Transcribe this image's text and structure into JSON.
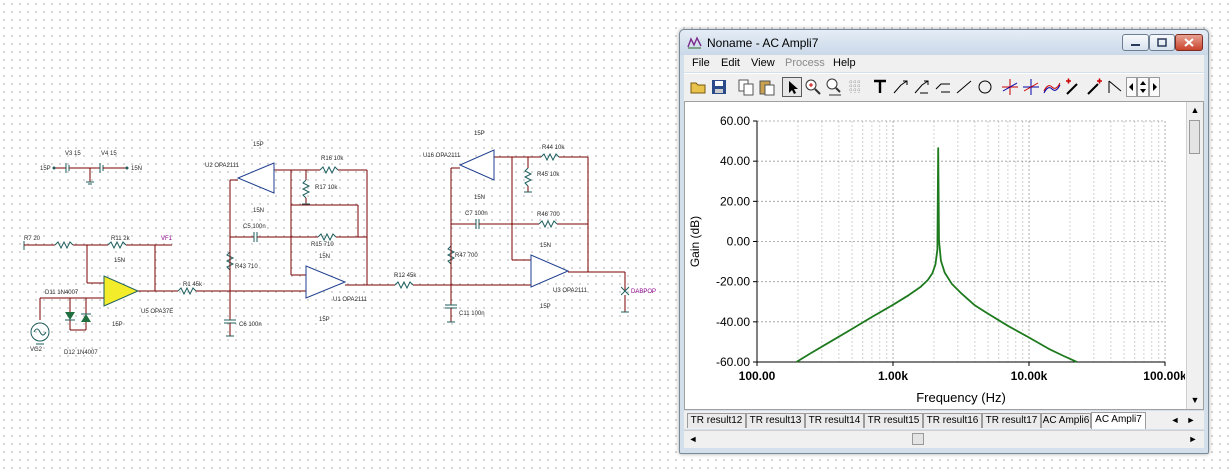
{
  "schematic": {
    "labels": {
      "v3": "V3 15",
      "v4": "V4 15",
      "p15_left": "15P",
      "n15_right": "15N",
      "r7": "R7 20",
      "r11": "R11 2k",
      "vf1": "VF1",
      "d11": "D11 1N4007",
      "d12": "D12 1N4007",
      "vg2": "VG2",
      "u5": "U5 OPA37E",
      "u5_top": "15N",
      "u5_bot": "15P",
      "r1": "R1 45k",
      "u2": "U2 OPA2111",
      "u2_top": "15P",
      "u2_bot": "15N",
      "r16": "R16 10k",
      "r17": "R17 10k",
      "c5": "C5 100n",
      "r15": "R15 710",
      "r43": "R43 710",
      "c6": "C6 100n",
      "u1": "U1 OPA2111",
      "u1_top": "15N",
      "u1_bot": "15P",
      "r12": "R12 45k",
      "u16": "U16 OPA2111",
      "u16_top": "15P",
      "u16_bot": "15N",
      "r44": "R44 10k",
      "r45": "R45 10k",
      "c7": "C7 100n",
      "r46": "R46 700",
      "r47": "R47 700",
      "c11": "C11 100n",
      "u3": "U3 OPA2111",
      "u3_top": "15N",
      "u3_bot": "15P",
      "dabpop": "DABPOP"
    }
  },
  "window": {
    "title": "Noname - AC Ampli7",
    "menu": [
      "File",
      "Edit",
      "View",
      "Process",
      "Help"
    ],
    "tabs": [
      "TR result12",
      "TR result13",
      "TR result14",
      "TR result15",
      "TR result16",
      "TR result17",
      "AC Ampli6",
      "AC Ampli7"
    ],
    "active_tab": "AC Ampli7",
    "toolbar_icons": [
      "open-icon",
      "save-icon",
      "copy-icon",
      "paste-icon",
      "pointer-icon",
      "zoom-in-icon",
      "zoom-100-icon",
      "grid-icon",
      "text-icon",
      "annotate-icon",
      "annotate2-icon",
      "annotate3-icon",
      "line-icon",
      "circle-icon",
      "cursor-a-icon",
      "cursor-b-icon",
      "curves-icon",
      "marker-icon",
      "marker2-icon",
      "arrow-tool-icon",
      "scroll-left-icon",
      "scroll-updown-icon",
      "scroll-right-icon"
    ]
  },
  "chart_data": {
    "type": "line",
    "xscale": "log",
    "xlabel": "Frequency (Hz)",
    "ylabel": "Gain (dB)",
    "xlim": [
      100,
      100000
    ],
    "ylim": [
      -60,
      60
    ],
    "xticks": [
      "100.00",
      "1.00k",
      "10.00k",
      "100.00k"
    ],
    "yticks": [
      "60.00",
      "40.00",
      "20.00",
      "0.00",
      "-20.00",
      "-40.00",
      "-60.00"
    ],
    "grid": true,
    "series": [
      {
        "color": "#1e7a1e",
        "x": [
          195,
          250,
          350,
          500,
          700,
          1000,
          1300,
          1600,
          1800,
          1950,
          2050,
          2120,
          2150,
          2180,
          2250,
          2400,
          2700,
          3200,
          4000,
          5000,
          7000,
          10000,
          14000,
          18000,
          22500
        ],
        "y": [
          -60,
          -55.5,
          -49.7,
          -43.5,
          -37.6,
          -31.5,
          -26.8,
          -22.5,
          -19.2,
          -15.8,
          -11.5,
          -4.0,
          46.5,
          0.5,
          -9.5,
          -15.5,
          -21.0,
          -26.0,
          -31.8,
          -36.0,
          -42.0,
          -47.8,
          -53.5,
          -57.0,
          -60
        ]
      }
    ]
  }
}
